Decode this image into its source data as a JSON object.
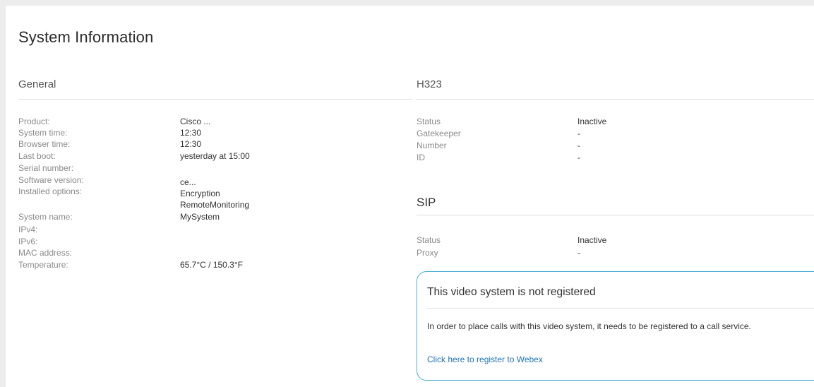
{
  "page": {
    "title": "System Information"
  },
  "general": {
    "heading": "General",
    "rows": [
      {
        "label": "Product:",
        "value": "Cisco ..."
      },
      {
        "label": "System time:",
        "value": "12:30"
      },
      {
        "label": "Browser time:",
        "value": "12:30"
      },
      {
        "label": "Last boot:",
        "value": "yesterday at 15:00"
      },
      {
        "label": "Serial number:",
        "value": ""
      },
      {
        "label": "Software version:",
        "value": "ce..."
      },
      {
        "label": "Installed options:",
        "value": "Encryption"
      },
      {
        "label": "",
        "value": "RemoteMonitoring"
      },
      {
        "label": "System name:",
        "value": "MySystem"
      },
      {
        "label": "IPv4:",
        "value": ""
      },
      {
        "label": "IPv6:",
        "value": ""
      },
      {
        "label": "MAC address:",
        "value": ""
      },
      {
        "label": "Temperature:",
        "value": "65.7°C / 150.3°F"
      }
    ]
  },
  "h323": {
    "heading": "H323",
    "rows": [
      {
        "label": "Status",
        "value": "Inactive"
      },
      {
        "label": "Gatekeeper",
        "value": "-"
      },
      {
        "label": "Number",
        "value": "-"
      },
      {
        "label": "ID",
        "value": "-"
      }
    ]
  },
  "sip": {
    "heading": "SIP",
    "rows": [
      {
        "label": "Status",
        "value": "Inactive"
      },
      {
        "label": "Proxy",
        "value": "-"
      }
    ]
  },
  "notice": {
    "title": "This video system is not registered",
    "text": "In order to place calls with this video system, it needs to be registered to a call service.",
    "link": "Click here to register to Webex"
  }
}
